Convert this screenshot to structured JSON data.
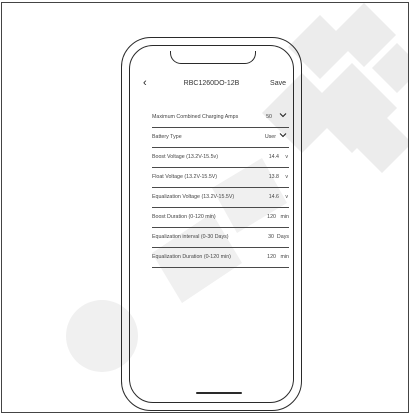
{
  "header": {
    "title": "RBC1260DO-12B",
    "save_label": "Save"
  },
  "settings": [
    {
      "label": "Maximum Combined Charging Amps",
      "value": "50",
      "control": "dropdown"
    },
    {
      "label": "Battery Type",
      "value": "User",
      "control": "dropdown"
    },
    {
      "label": "Boost Voltage (13.2V-15.5v)",
      "value": "14.4",
      "unit": "v"
    },
    {
      "label": "Float Voltage (13.2V-15.5V)",
      "value": "13.8",
      "unit": "v"
    },
    {
      "label": "Equalization Voltage (13.2V-15.5V)",
      "value": "14.6",
      "unit": "v"
    },
    {
      "label": "Boost Duration (0-120 min)",
      "value": "120",
      "unit": "min"
    },
    {
      "label": "Equalization interval (0-30 Days)",
      "value": "30",
      "unit": "Days"
    },
    {
      "label": "Equalization Duration (0-120 min)",
      "value": "120",
      "unit": "min"
    }
  ],
  "icons": {
    "back": "chevron-left-icon",
    "dropdown": "chevron-down-icon"
  },
  "colors": {
    "watermark": "#e6e6e6",
    "outline": "#2a2a2a"
  }
}
